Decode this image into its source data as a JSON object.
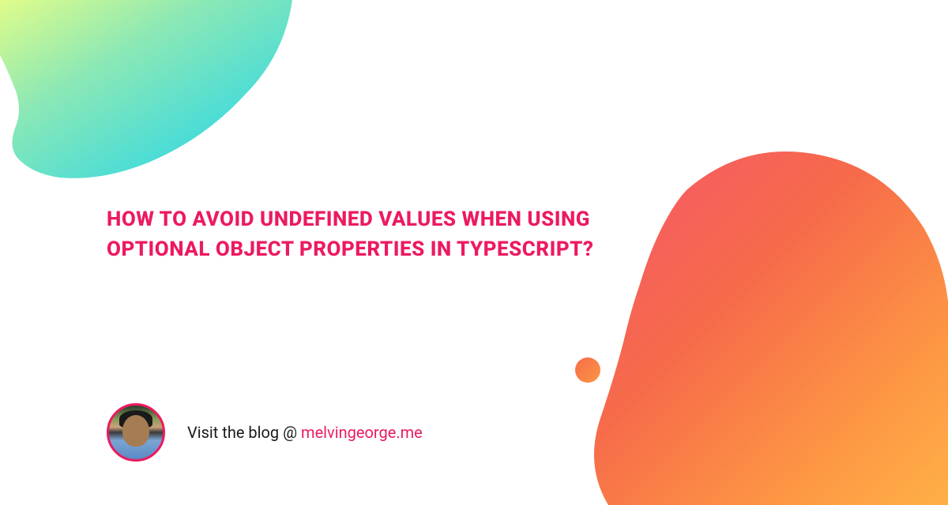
{
  "title": "HOW TO AVOID UNDEFINED VALUES WHEN USING OPTIONAL OBJECT PROPERTIES IN TYPESCRIPT?",
  "footer": {
    "prefix": "Visit the blog @ ",
    "link_text": "melvingeorge.me"
  },
  "colors": {
    "accent": "#ec1a5f",
    "blob_tl_start": "#d4fc79",
    "blob_tl_end": "#3fc9d6",
    "blob_br_start": "#f5576c",
    "blob_br_end": "#feb047"
  }
}
